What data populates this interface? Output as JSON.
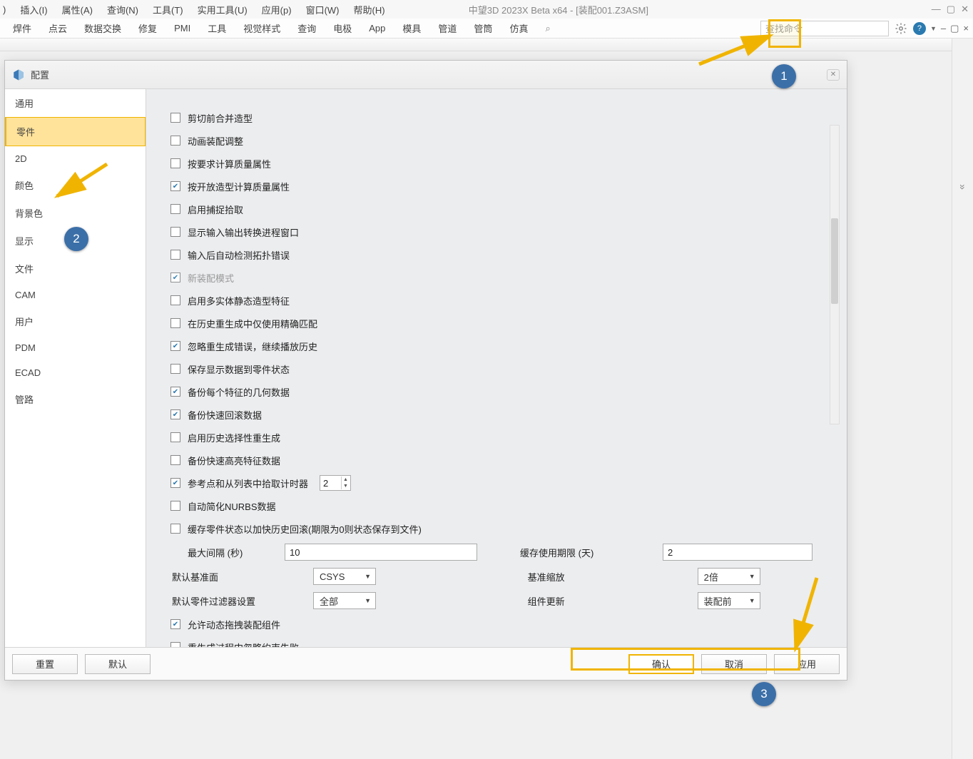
{
  "menubar": {
    "items": [
      "插入(I)",
      "属性(A)",
      "查询(N)",
      "工具(T)",
      "实用工具(U)",
      "应用(p)",
      "窗口(W)",
      "帮助(H)"
    ],
    "title": "中望3D 2023X Beta x64 - [装配001.Z3ASM]"
  },
  "ribbon": {
    "tabs": [
      "焊件",
      "点云",
      "数据交换",
      "修复",
      "PMI",
      "工具",
      "视觉样式",
      "查询",
      "电极",
      "App",
      "模具",
      "管道",
      "管筒",
      "仿真"
    ],
    "search_placeholder": "查找命令"
  },
  "dialog": {
    "title": "配置",
    "categories": [
      "通用",
      "零件",
      "2D",
      "颜色",
      "背景色",
      "显示",
      "文件",
      "CAM",
      "用户",
      "PDM",
      "ECAD",
      "管路"
    ],
    "selected_category_index": 1,
    "checks": [
      {
        "label": "剪切前合并造型",
        "on": false
      },
      {
        "label": "动画装配调整",
        "on": false
      },
      {
        "label": "按要求计算质量属性",
        "on": false
      },
      {
        "label": "按开放造型计算质量属性",
        "on": true
      },
      {
        "label": "启用捕捉拾取",
        "on": false
      },
      {
        "label": "显示输入输出转换进程窗口",
        "on": false
      },
      {
        "label": "输入后自动检测拓扑错误",
        "on": false
      },
      {
        "label": "新装配模式",
        "on": true,
        "disabled": true
      },
      {
        "label": "启用多实体静态造型特征",
        "on": false
      },
      {
        "label": "在历史重生成中仅使用精确匹配",
        "on": false
      },
      {
        "label": "忽略重生成错误，继续播放历史",
        "on": true
      },
      {
        "label": "保存显示数据到零件状态",
        "on": false
      },
      {
        "label": "备份每个特征的几何数据",
        "on": true
      },
      {
        "label": "备份快速回滚数据",
        "on": true
      },
      {
        "label": "启用历史选择性重生成",
        "on": false
      },
      {
        "label": "备份快速高亮特征数据",
        "on": false
      }
    ],
    "timer": {
      "label": "参考点和从列表中拾取计时器",
      "on": true,
      "value": "2"
    },
    "nurbs": {
      "label": "自动简化NURBS数据",
      "on": false
    },
    "cache": {
      "label": "缓存零件状态以加快历史回滚(期限为0则状态保存到文件)",
      "on": false
    },
    "max_interval": {
      "label": "最大间隔 (秒)",
      "value": "10"
    },
    "cache_limit": {
      "label": "缓存使用期限 (天)",
      "value": "2"
    },
    "default_plane": {
      "label": "默认基准面",
      "value": "CSYS"
    },
    "base_scale": {
      "label": "基准缩放",
      "value": "2倍"
    },
    "default_filter": {
      "label": "默认零件过滤器设置",
      "value": "全部"
    },
    "component_update": {
      "label": "组件更新",
      "value": "装配前"
    },
    "allow_drag": {
      "label": "允许动态拖拽装配组件",
      "on": true
    },
    "ignore_constraint": {
      "label": "重生成过程中忽略约束失败",
      "on": false
    },
    "buttons": {
      "reset": "重置",
      "default": "默认",
      "ok": "确认",
      "cancel": "取消",
      "apply": "应用"
    }
  },
  "callouts": {
    "c1": "1",
    "c2": "2",
    "c3": "3"
  }
}
